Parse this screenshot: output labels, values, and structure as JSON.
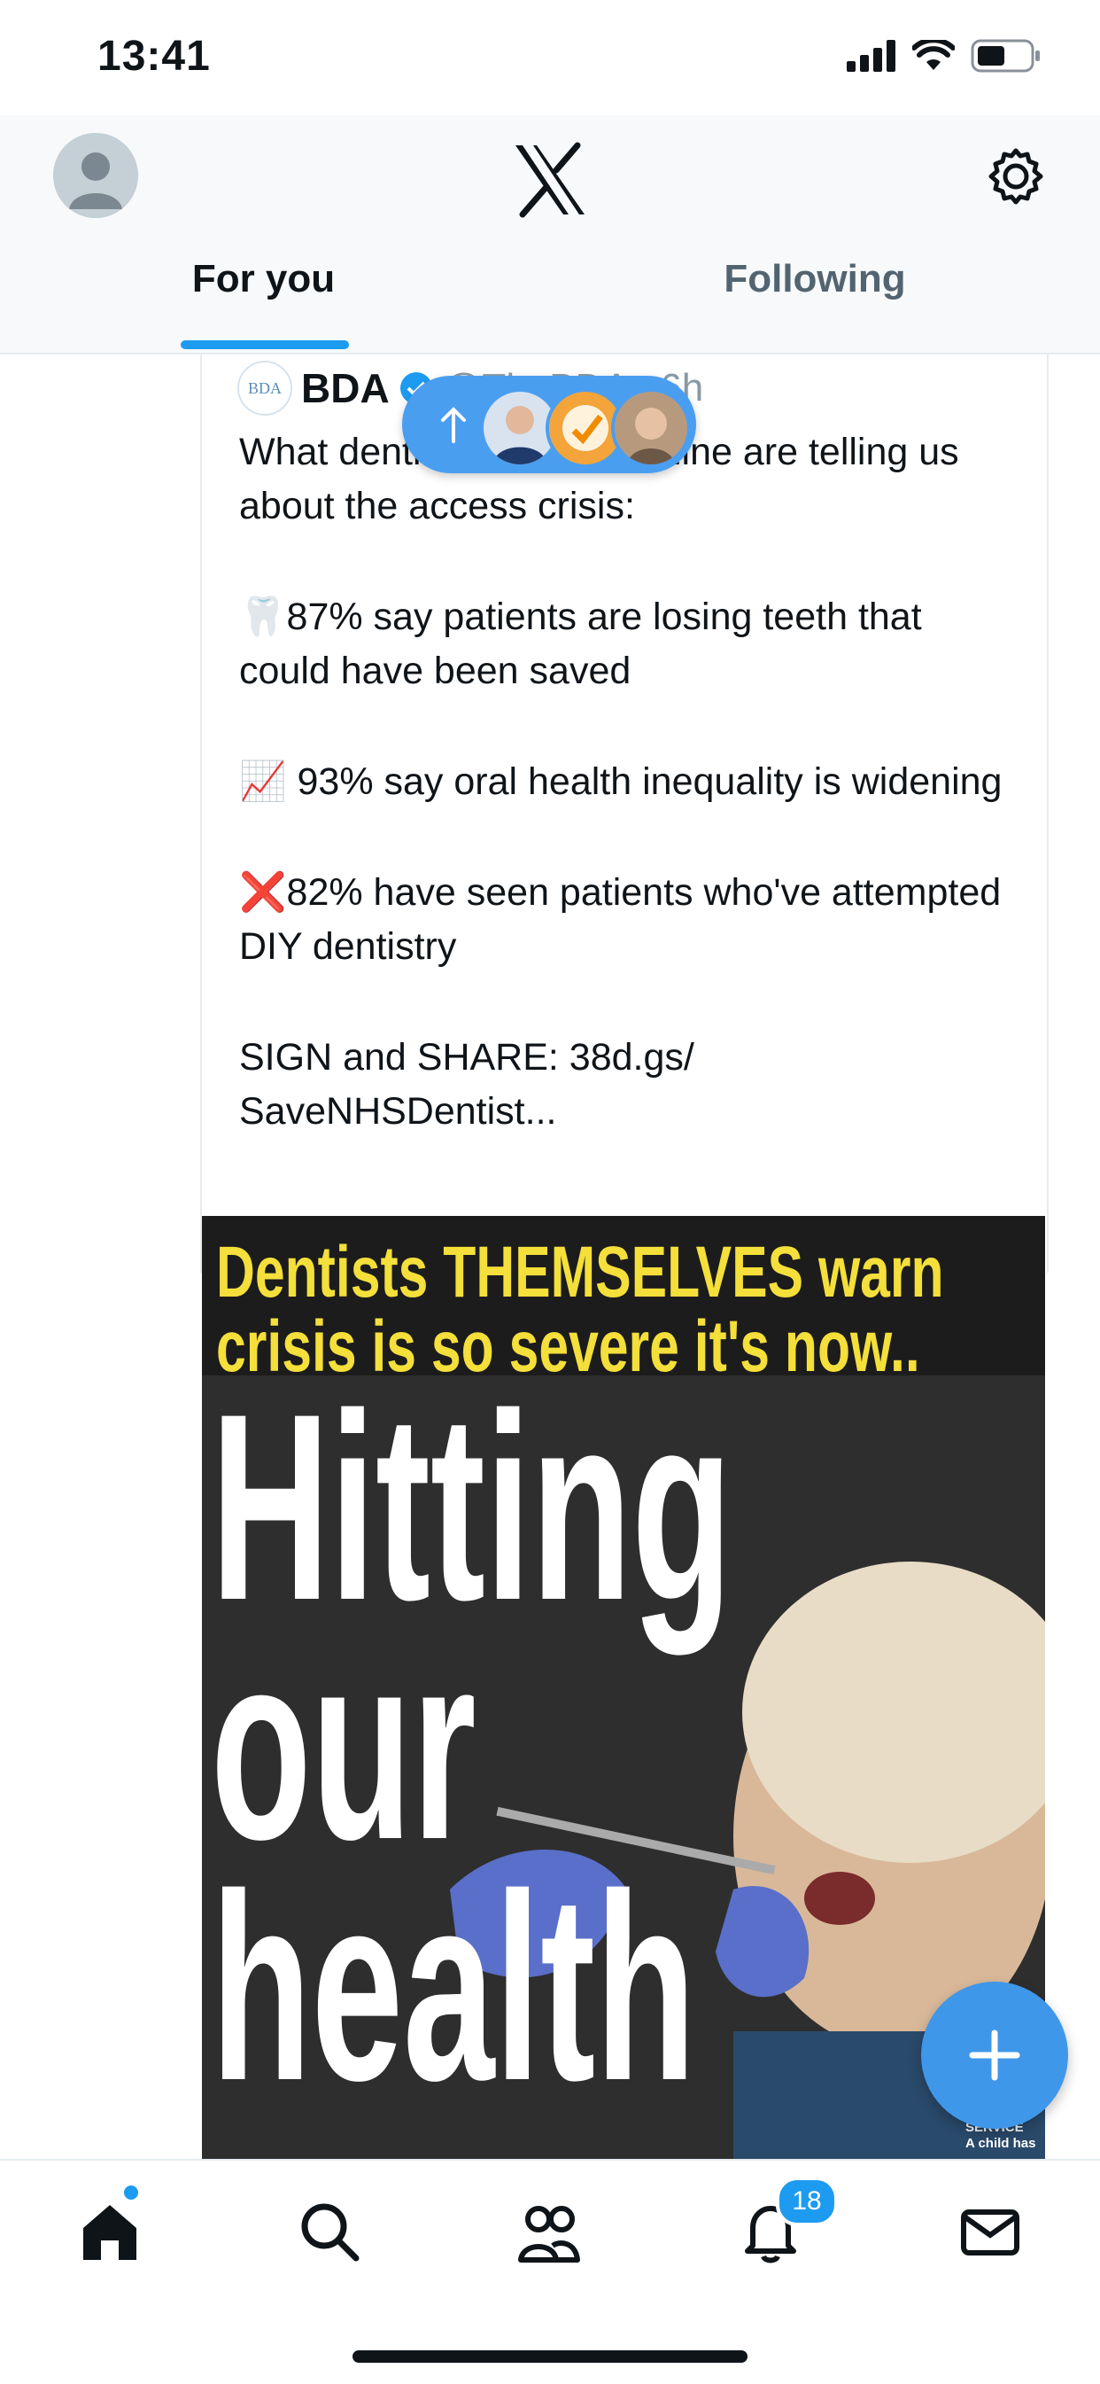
{
  "status_bar": {
    "time": "13:41"
  },
  "header": {
    "tabs": [
      {
        "label": "For you",
        "active": true
      },
      {
        "label": "Following",
        "active": false
      }
    ]
  },
  "tweet": {
    "author": "BDA",
    "logo_text": "BDA",
    "handle": "@TheBDA",
    "time": "6h",
    "lines": [
      "What dentists on the frontline are telling us about the access crisis:",
      "🦷87% say patients are losing teeth that could have been saved",
      "📈 93% say oral health inequality is widening",
      "❌82% have seen patients who've attempted DIY dentistry",
      "SIGN and SHARE: 38d.gs/\nSaveNHSDentist..."
    ]
  },
  "media": {
    "headline_yellow_1": "Dentists THEMSELVES warn",
    "headline_yellow_2": "crisis is so severe it's now..",
    "headline_white_1": "Hitting",
    "headline_white_2": "our",
    "headline_white_3": "health",
    "caption": "SERVICE\nA child has"
  },
  "bottom_nav": {
    "notifications_badge": "18",
    "items": [
      "home-icon",
      "search-icon",
      "communities-icon",
      "notifications-icon",
      "messages-icon"
    ]
  },
  "colors": {
    "accent": "#1d9bf0",
    "pill": "#4a9ef0",
    "fab": "#3f97ea",
    "headline_yellow": "#f4df3b"
  }
}
